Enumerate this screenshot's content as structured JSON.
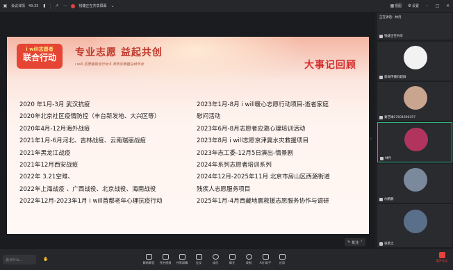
{
  "topbar": {
    "app_name": "会议详情",
    "timer": "40:25",
    "recording_label": "钱婕正在共享屏幕",
    "right_items": [
      "视图",
      "设置"
    ]
  },
  "slide": {
    "logo_top": "i will志愿者",
    "logo_bottom": "联合行动",
    "slogan": "专业志愿  益起共创",
    "subline": "i will 志愿者联合行动 6 周年庆典暨总结年会",
    "title": "大事记回顾",
    "left_events": [
      "2020 年1月-3月 武汉抗疫",
      "2020年北京社区疫情防控（丰台新发地、大兴区等）",
      "2020年4月-12月海外战疫",
      "2021年1月-6月河北、吉林战疫、云南瑞丽战疫",
      "2021年黑龙江战疫",
      "2021年12月西安战疫",
      "2022年 3.21空难、",
      "2022年上海战疫 、广西战役、北京战役、海南战役",
      "2022年12月-2023年1月 i will首都老年心理抗疫行动"
    ],
    "right_events": [
      "2023年1月-8月 i will暖心志愿行动项目-逝者家庭",
      "慰问活动",
      "2023年6月-8月志愿者应激心理培训活动",
      "2023年8月 i will志愿京津冀水灾救援项目",
      "2023年志工委-12月5日演出-情景剧",
      "2024年系列志愿者培训系列",
      "2024年12月-2025年11月  北京市房山区西潞街道",
      "残疾人志愿服务项目",
      "2025年1月-4月西藏地震救援志愿服务协作与调研"
    ]
  },
  "annotation_label": "批注",
  "participants": {
    "speaking_label": "正在讲话：林丹",
    "items": [
      {
        "name": "钱婕正在共享"
      },
      {
        "name": "新闻传播刘超群"
      },
      {
        "name": "秦艺琳17601690357"
      },
      {
        "name": "林丹"
      },
      {
        "name": "尔鹏鹏"
      },
      {
        "name": "张景之"
      }
    ]
  },
  "bottombar": {
    "chat_placeholder": "说点什么...",
    "tools": [
      "解除静音",
      "开启视频",
      "共享屏幕",
      "会议",
      "成员",
      "聊天",
      "录制",
      "AI小助手",
      "应用"
    ],
    "exit_label": "离开会议"
  },
  "colors": {
    "accent_red": "#d22e2e",
    "active_green": "#2fb67c",
    "exit_red": "#e9403b"
  }
}
